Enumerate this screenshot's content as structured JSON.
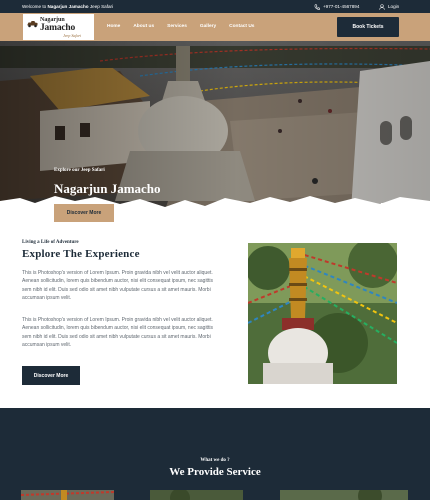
{
  "topbar": {
    "welcome_prefix": "Welcome to",
    "welcome_brand": "Nagarjun Jamacho",
    "welcome_suffix": "Jeep Safari",
    "phone": "+977-01-4567894",
    "login": "Login"
  },
  "logo": {
    "line1": "Nagarjun",
    "line2": "Jamacho",
    "line3": "Jeep Safari"
  },
  "nav": {
    "items": [
      "Home",
      "About us",
      "Services",
      "Gallery",
      "Contact Us"
    ],
    "cta": "Book Tickets"
  },
  "hero": {
    "eyebrow": "Explore our Jeep Safari",
    "title": "Nagarjun Jamacho",
    "button": "Discover More"
  },
  "about": {
    "eyebrow": "Living a Life of Adventure",
    "title": "Explore The  Experience",
    "paragraphs": [
      "This is Photoshop's version of Lorem Ipsum. Proin gravida nibh vel velit auctor aliquet. Aenean sollicitudin, lorem quis bibendum auctor, nisi elit consequat ipsum, nec sagittis sem nibh id elit. Duis sed odio sit amet nibh vulputate cursus a sit amet mauris. Morbi accumsan ipsum velit.",
      "This is Photoshop's version of Lorem Ipsum. Proin gravida nibh vel velit auctor aliquet. Aenean sollicitudin, lorem quis bibendum auctor, nisi elit consequat ipsum, nec sagittis sem nibh id elit. Duis sed odio sit amet nibh vulputate cursus a sit amet mauris. Morbi accumsan ipsum velit."
    ],
    "button": "Discover More"
  },
  "service": {
    "eyebrow": "What we do ?",
    "title": "We Provide  Service"
  },
  "colors": {
    "navy": "#1d2b38",
    "tan": "#c9a27a"
  },
  "icons": {
    "phone": "phone-icon",
    "user": "user-icon",
    "prev": "chevron-left-icon",
    "next": "chevron-right-icon"
  }
}
